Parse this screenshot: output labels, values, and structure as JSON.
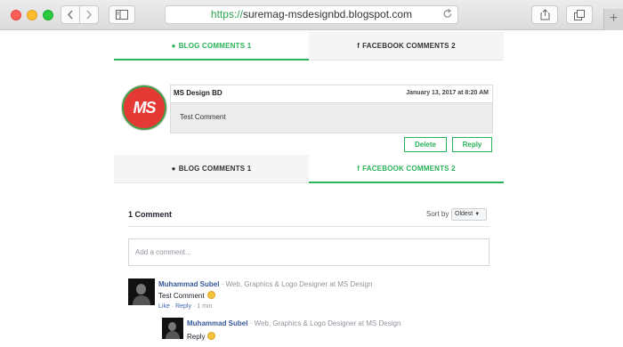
{
  "browser": {
    "url_scheme": "https://",
    "url_host": "suremag-msdesignbd.blogspot.com",
    "icons": [
      "back-icon",
      "forward-icon",
      "sidebar-icon",
      "reload-icon",
      "share-icon",
      "tabs-icon",
      "new-tab-icon"
    ]
  },
  "tabs_top": {
    "blog_label": "BLOG COMMENTS 1",
    "facebook_label": "FACEBOOK COMMENTS 2",
    "active": "blog"
  },
  "blog_comment": {
    "avatar_text": "MS",
    "author": "MS Design BD",
    "date": "January 13, 2017 at 8:20 AM",
    "body": "Test Comment",
    "delete_label": "Delete",
    "reply_label": "Reply"
  },
  "tabs_bottom": {
    "blog_label": "BLOG COMMENTS 1",
    "facebook_label": "FACEBOOK COMMENTS 2",
    "active": "facebook"
  },
  "facebook": {
    "count_label": "1 Comment",
    "sort_label": "Sort by",
    "sort_value": "Oldest",
    "input_placeholder": "Add a comment...",
    "comments": [
      {
        "name": "Muhammad Subel",
        "role": "· Web, Graphics & Logo Designer at MS Design",
        "text": "Test Comment",
        "like": "Like",
        "sep1": "·",
        "reply": "Reply",
        "sep2": "·",
        "time": "1 min"
      },
      {
        "name": "Muhammad Subel",
        "role": "· Web, Graphics & Logo Designer at MS Design",
        "text": "Reply"
      }
    ]
  },
  "colors": {
    "accent_green": "#2ab35a",
    "fb_link": "#365899",
    "avatar_red": "#e53935"
  }
}
